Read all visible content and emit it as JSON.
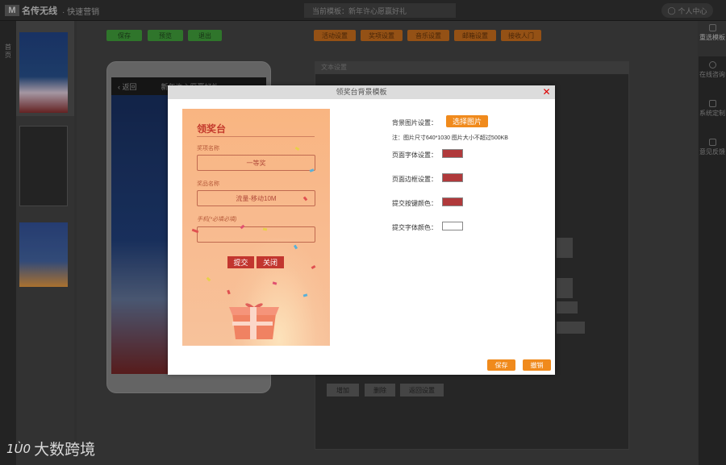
{
  "app": {
    "logo_text": "名传无线",
    "logo_tag": "· 快速营销",
    "current_template": "当前模板：新年许心愿赢好礼",
    "user_center": "个人中心"
  },
  "left_nav": {
    "home": "首页"
  },
  "toolbar_left": [
    "保存",
    "预览",
    "退出"
  ],
  "toolbar_right": [
    "活动设置",
    "奖项设置",
    "音乐设置",
    "邮箱设置",
    "接收人门"
  ],
  "phone": {
    "back": "返回",
    "title": "新年许心愿赢好礼"
  },
  "settings_panel": {
    "header": "文本设置",
    "buttons": [
      "增加",
      "删除",
      "返回设置"
    ]
  },
  "right_nav": [
    {
      "label": "重选模板",
      "icon": "template-icon",
      "active": true
    },
    {
      "label": "在线咨询",
      "icon": "chat-icon",
      "active": false
    },
    {
      "label": "系统定制",
      "icon": "custom-icon",
      "active": false
    },
    {
      "label": "意见反馈",
      "icon": "feedback-icon",
      "active": false
    }
  ],
  "modal": {
    "title": "领奖台背景模板",
    "preview": {
      "title": "领奖台",
      "field1_label": "奖项名称",
      "field1_value": "一等奖",
      "field2_label": "奖品名称",
      "field2_value": "流量-移动10M",
      "field3_label": "手机(*必填必填)",
      "submit": "提交",
      "close": "关闭"
    },
    "settings": {
      "bg_label": "背景图片设置：",
      "select_image": "选择图片",
      "note": "注：图片尺寸640*1030 图片大小不超过500KB",
      "font_label": "页面字体设置：",
      "border_label": "页面边框设置：",
      "submit_btn_label": "提交按键颜色：",
      "submit_font_label": "提交字体颜色："
    },
    "colors": {
      "font": "#b0393b",
      "border": "#b0393b",
      "submit_btn": "#b0393b",
      "submit_font": "#ffffff"
    },
    "save": "保存",
    "cancel": "撤销"
  },
  "watermark": {
    "logo": "1Ù0",
    "text": "大数跨境"
  }
}
